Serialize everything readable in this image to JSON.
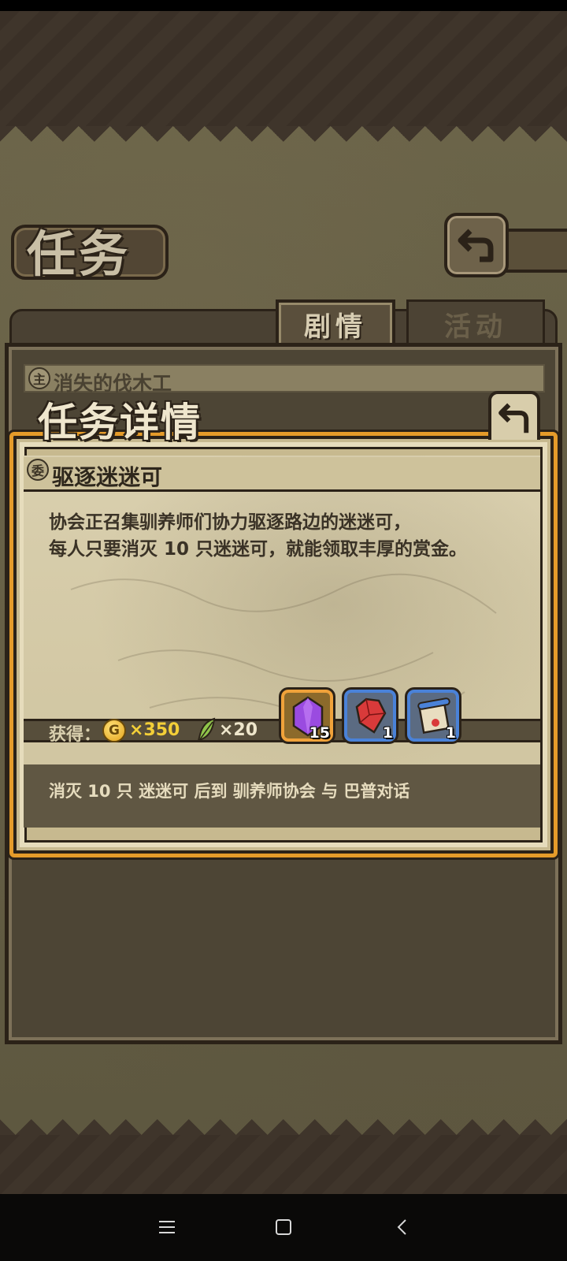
{
  "header": {
    "title": "任务",
    "back_icon": "return-arrow-icon"
  },
  "tabs": [
    {
      "label": "剧情",
      "active": true
    },
    {
      "label": "活动",
      "active": false
    }
  ],
  "mission_list": {
    "item_badge": "主",
    "item_title": "消失的伐木工"
  },
  "detail": {
    "title": "任务详情",
    "back_icon": "return-arrow-icon",
    "quest_badge": "委",
    "quest_name": "驱逐迷迷可",
    "description_line1": "协会正召集驯养师们协力驱逐路边的迷迷可，",
    "description_line2": "每人只要消灭 10 只迷迷可，就能领取丰厚的赏金。",
    "rewards_label": "获得：",
    "coin_symbol": "G",
    "coin_amount": "×350",
    "feather_amount": "×20",
    "items": [
      {
        "name": "purple-crystal-icon",
        "count": "15",
        "frame": "gold"
      },
      {
        "name": "red-gem-icon",
        "count": "1",
        "frame": "blue"
      },
      {
        "name": "scroll-icon",
        "count": "1",
        "frame": "blue"
      }
    ],
    "objective": "消灭 10 只 迷迷可 后到 驯养师协会 与 巴普对话"
  },
  "navbar": {
    "menu_icon": "menu-icon",
    "home_icon": "home-square-icon",
    "back_icon": "back-chevron-icon"
  },
  "colors": {
    "frame_orange": "#e59b2a",
    "coin_text": "#f3cf38",
    "slot_blue": "#4a82d8",
    "parchment": "#d9cfae"
  }
}
